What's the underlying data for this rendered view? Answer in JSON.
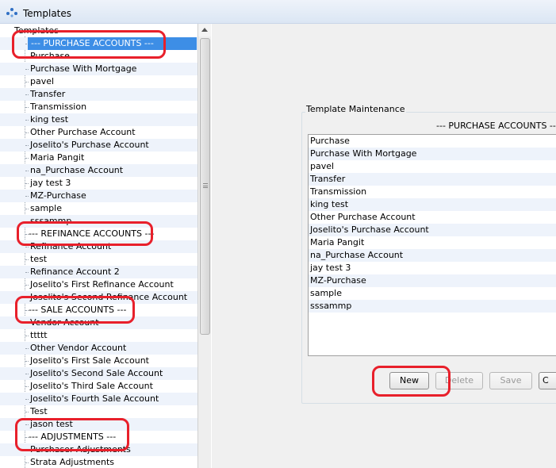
{
  "window": {
    "title": "Templates"
  },
  "tree": {
    "root_label": "Templates",
    "items": [
      {
        "label": "--- PURCHASE ACCOUNTS ---",
        "divider": true,
        "selected": true
      },
      {
        "label": "Purchase"
      },
      {
        "label": "Purchase With Mortgage"
      },
      {
        "label": "pavel"
      },
      {
        "label": "Transfer"
      },
      {
        "label": "Transmission"
      },
      {
        "label": "king test"
      },
      {
        "label": "Other Purchase Account"
      },
      {
        "label": "Joselito's Purchase Account"
      },
      {
        "label": "Maria Pangit"
      },
      {
        "label": "na_Purchase Account"
      },
      {
        "label": "jay test 3"
      },
      {
        "label": "MZ-Purchase"
      },
      {
        "label": "sample"
      },
      {
        "label": "sssammp"
      },
      {
        "label": "--- REFINANCE ACCOUNTS ---",
        "divider": true
      },
      {
        "label": "Refinance Account"
      },
      {
        "label": "test"
      },
      {
        "label": "Refinance Account 2"
      },
      {
        "label": "Joselito's First Refinance Account"
      },
      {
        "label": "Joselito's Second Refinance Account"
      },
      {
        "label": "--- SALE ACCOUNTS ---",
        "divider": true
      },
      {
        "label": "Vendor Account"
      },
      {
        "label": "ttttt"
      },
      {
        "label": "Other Vendor Account"
      },
      {
        "label": "Joselito's First Sale Account"
      },
      {
        "label": "Joselito's Second Sale Account"
      },
      {
        "label": "Joselito's Third Sale Account"
      },
      {
        "label": "Joselito's Fourth Sale Account"
      },
      {
        "label": "Test"
      },
      {
        "label": "jason test"
      },
      {
        "label": "--- ADJUSTMENTS ---",
        "divider": true
      },
      {
        "label": "Purchaser Adjustments"
      },
      {
        "label": "Strata Adjustments"
      }
    ]
  },
  "maintenance": {
    "group_title": "Template Maintenance",
    "heading": "--- PURCHASE ACCOUNTS ---",
    "items": [
      "Purchase",
      "Purchase With Mortgage",
      "pavel",
      "Transfer",
      "Transmission",
      "king test",
      "Other Purchase Account",
      "Joselito's Purchase Account",
      "Maria Pangit",
      "na_Purchase Account",
      "jay test 3",
      "MZ-Purchase",
      "sample",
      "sssammp"
    ],
    "buttons": {
      "new": "New",
      "delete": "Delete",
      "save": "Save",
      "close": "C"
    }
  },
  "colors": {
    "selection": "#3d8ee6",
    "annotation": "#e8202b",
    "row_alt": "#eef3fb"
  }
}
